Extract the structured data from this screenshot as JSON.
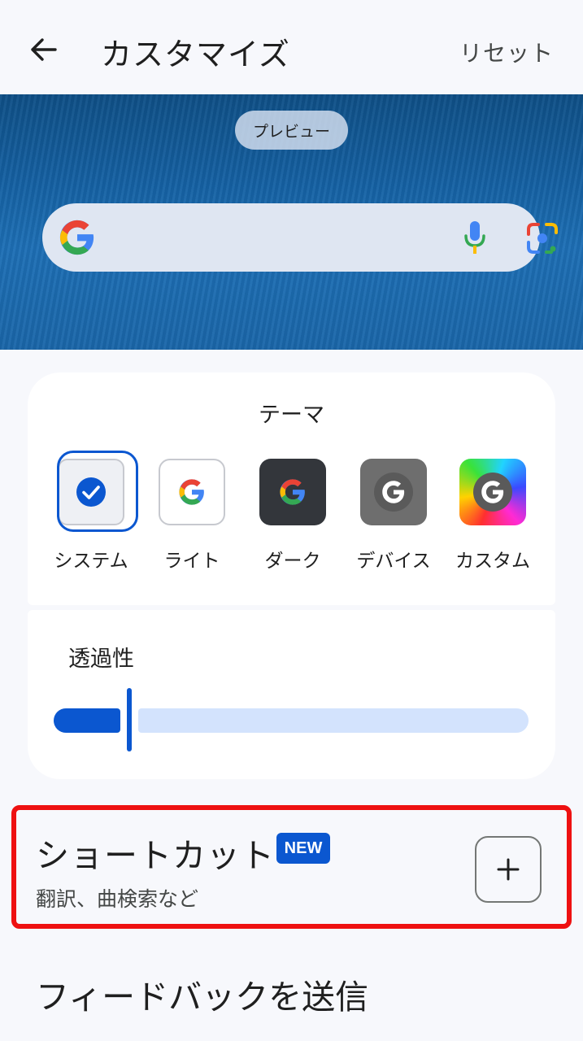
{
  "header": {
    "back_icon": "arrow-left-icon",
    "title": "カスタマイズ",
    "reset_label": "リセット"
  },
  "preview": {
    "chip_label": "プレビュー",
    "search_bar": {
      "logo_icon": "google-g-icon",
      "mic_icon": "microphone-icon",
      "lens_icon": "google-lens-icon"
    }
  },
  "theme": {
    "title": "テーマ",
    "selected": "システム",
    "options": [
      {
        "label": "システム",
        "icon": "check-circle-icon"
      },
      {
        "label": "ライト",
        "icon": "google-g-icon"
      },
      {
        "label": "ダーク",
        "icon": "google-g-icon"
      },
      {
        "label": "デバイス",
        "icon": "google-g-icon"
      },
      {
        "label": "カスタム",
        "icon": "google-g-icon"
      }
    ]
  },
  "transparency": {
    "label": "透過性",
    "value_fraction": 0.16
  },
  "shortcut": {
    "title": "ショートカット",
    "badge": "NEW",
    "subtitle": "翻訳、曲検索など",
    "add_icon": "plus-icon"
  },
  "feedback": {
    "label": "フィードバックを送信"
  },
  "colors": {
    "accent": "#0b57d0",
    "highlight_box": "#ee1111",
    "background": "#f7f8fc"
  }
}
